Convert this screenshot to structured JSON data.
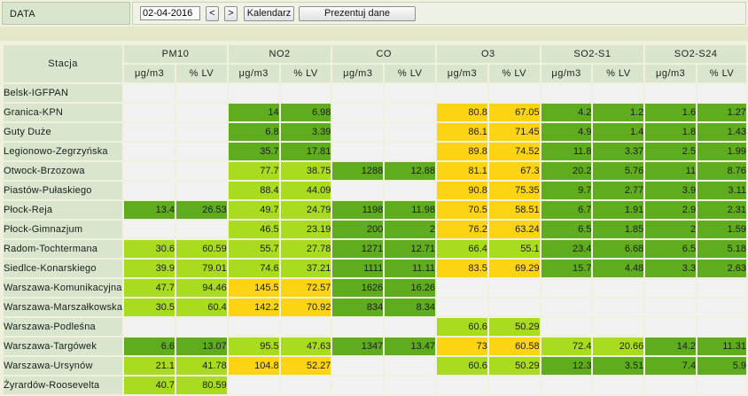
{
  "toolbar": {
    "date_label": "DATA",
    "date_value": "02-04-2016",
    "prev_label": "<",
    "next_label": ">",
    "calendar_label": "Kalendarz",
    "show_label": "Prezentuj dane"
  },
  "table": {
    "station_header": "Stacja",
    "groups": [
      "PM10",
      "NO2",
      "CO",
      "O3",
      "SO2-S1",
      "SO2-S24"
    ],
    "units": [
      "μg/m3",
      "% LV"
    ],
    "colors": {
      "e": "#f2f2f2",
      "dg": "#5fad1f",
      "lg": "#a9db1e",
      "y": "#fdd414"
    },
    "rows": [
      {
        "name": "Belsk-IGFPAN",
        "cells": [
          [
            "",
            ""
          ],
          [
            "",
            ""
          ],
          [
            "",
            ""
          ],
          [
            "",
            ""
          ],
          [
            "",
            ""
          ],
          [
            "",
            ""
          ]
        ],
        "colors": [
          "e",
          "e",
          "e",
          "e",
          "e",
          "e"
        ]
      },
      {
        "name": "Granica-KPN",
        "cells": [
          [
            "",
            ""
          ],
          [
            "14",
            "6.98"
          ],
          [
            "",
            ""
          ],
          [
            "80.8",
            "67.05"
          ],
          [
            "4.2",
            "1.2"
          ],
          [
            "1.6",
            "1.27"
          ]
        ],
        "colors": [
          "e",
          "dg",
          "e",
          "y",
          "dg",
          "dg"
        ]
      },
      {
        "name": "Guty Duże",
        "cells": [
          [
            "",
            ""
          ],
          [
            "6.8",
            "3.39"
          ],
          [
            "",
            ""
          ],
          [
            "86.1",
            "71.45"
          ],
          [
            "4.9",
            "1.4"
          ],
          [
            "1.8",
            "1.43"
          ]
        ],
        "colors": [
          "e",
          "dg",
          "e",
          "y",
          "dg",
          "dg"
        ]
      },
      {
        "name": "Legionowo-Zegrzyńska",
        "cells": [
          [
            "",
            ""
          ],
          [
            "35.7",
            "17.81"
          ],
          [
            "",
            ""
          ],
          [
            "89.8",
            "74.52"
          ],
          [
            "11.8",
            "3.37"
          ],
          [
            "2.5",
            "1.99"
          ]
        ],
        "colors": [
          "e",
          "dg",
          "e",
          "y",
          "dg",
          "dg"
        ]
      },
      {
        "name": "Otwock-Brzozowa",
        "cells": [
          [
            "",
            ""
          ],
          [
            "77.7",
            "38.75"
          ],
          [
            "1288",
            "12.88"
          ],
          [
            "81.1",
            "67.3"
          ],
          [
            "20.2",
            "5.76"
          ],
          [
            "11",
            "8.76"
          ]
        ],
        "colors": [
          "e",
          "lg",
          "dg",
          "y",
          "dg",
          "dg"
        ]
      },
      {
        "name": "Piastów-Pułaskiego",
        "cells": [
          [
            "",
            ""
          ],
          [
            "88.4",
            "44.09"
          ],
          [
            "",
            ""
          ],
          [
            "90.8",
            "75.35"
          ],
          [
            "9.7",
            "2.77"
          ],
          [
            "3.9",
            "3.11"
          ]
        ],
        "colors": [
          "e",
          "lg",
          "e",
          "y",
          "dg",
          "dg"
        ]
      },
      {
        "name": "Płock-Reja",
        "cells": [
          [
            "13.4",
            "26.53"
          ],
          [
            "49.7",
            "24.79"
          ],
          [
            "1198",
            "11.98"
          ],
          [
            "70.5",
            "58.51"
          ],
          [
            "6.7",
            "1.91"
          ],
          [
            "2.9",
            "2.31"
          ]
        ],
        "colors": [
          "dg",
          "lg",
          "dg",
          "y",
          "dg",
          "dg"
        ]
      },
      {
        "name": "Płock-Gimnazjum",
        "cells": [
          [
            "",
            ""
          ],
          [
            "46.5",
            "23.19"
          ],
          [
            "200",
            "2"
          ],
          [
            "76.2",
            "63.24"
          ],
          [
            "6.5",
            "1.85"
          ],
          [
            "2",
            "1.59"
          ]
        ],
        "colors": [
          "e",
          "lg",
          "dg",
          "y",
          "dg",
          "dg"
        ]
      },
      {
        "name": "Radom-Tochtermana",
        "cells": [
          [
            "30.6",
            "60.59"
          ],
          [
            "55.7",
            "27.78"
          ],
          [
            "1271",
            "12.71"
          ],
          [
            "66.4",
            "55.1"
          ],
          [
            "23.4",
            "6.68"
          ],
          [
            "6.5",
            "5.18"
          ]
        ],
        "colors": [
          "lg",
          "lg",
          "dg",
          "lg",
          "dg",
          "dg"
        ]
      },
      {
        "name": "Siedlce-Konarskiego",
        "cells": [
          [
            "39.9",
            "79.01"
          ],
          [
            "74.6",
            "37.21"
          ],
          [
            "1111",
            "11.11"
          ],
          [
            "83.5",
            "69.29"
          ],
          [
            "15.7",
            "4.48"
          ],
          [
            "3.3",
            "2.63"
          ]
        ],
        "colors": [
          "lg",
          "lg",
          "dg",
          "y",
          "dg",
          "dg"
        ]
      },
      {
        "name": "Warszawa-Komunikacyjna",
        "cells": [
          [
            "47.7",
            "94.46"
          ],
          [
            "145.5",
            "72.57"
          ],
          [
            "1626",
            "16.26"
          ],
          [
            "",
            ""
          ],
          [
            "",
            ""
          ],
          [
            "",
            ""
          ]
        ],
        "colors": [
          "lg",
          "y",
          "dg",
          "e",
          "e",
          "e"
        ]
      },
      {
        "name": "Warszawa-Marszałkowska",
        "cells": [
          [
            "30.5",
            "60.4"
          ],
          [
            "142.2",
            "70.92"
          ],
          [
            "834",
            "8.34"
          ],
          [
            "",
            ""
          ],
          [
            "",
            ""
          ],
          [
            "",
            ""
          ]
        ],
        "colors": [
          "lg",
          "y",
          "dg",
          "e",
          "e",
          "e"
        ]
      },
      {
        "name": "Warszawa-Podleśna",
        "cells": [
          [
            "",
            ""
          ],
          [
            "",
            ""
          ],
          [
            "",
            ""
          ],
          [
            "60.6",
            "50.29"
          ],
          [
            "",
            ""
          ],
          [
            "",
            ""
          ]
        ],
        "colors": [
          "e",
          "e",
          "e",
          "lg",
          "e",
          "e"
        ]
      },
      {
        "name": "Warszawa-Targówek",
        "cells": [
          [
            "6.6",
            "13.07"
          ],
          [
            "95.5",
            "47.63"
          ],
          [
            "1347",
            "13.47"
          ],
          [
            "73",
            "60.58"
          ],
          [
            "72.4",
            "20.66"
          ],
          [
            "14.2",
            "11.31"
          ]
        ],
        "colors": [
          "dg",
          "lg",
          "dg",
          "y",
          "lg",
          "dg"
        ]
      },
      {
        "name": "Warszawa-Ursynów",
        "cells": [
          [
            "21.1",
            "41.78"
          ],
          [
            "104.8",
            "52.27"
          ],
          [
            "",
            ""
          ],
          [
            "60.6",
            "50.29"
          ],
          [
            "12.3",
            "3.51"
          ],
          [
            "7.4",
            "5.9"
          ]
        ],
        "colors": [
          "lg",
          "y",
          "e",
          "lg",
          "dg",
          "dg"
        ]
      },
      {
        "name": "Żyrardów-Roosevelta",
        "cells": [
          [
            "40.7",
            "80.59"
          ],
          [
            "",
            ""
          ],
          [
            "",
            ""
          ],
          [
            "",
            ""
          ],
          [
            "",
            ""
          ],
          [
            "",
            ""
          ]
        ],
        "colors": [
          "lg",
          "e",
          "e",
          "e",
          "e",
          "e"
        ]
      }
    ]
  }
}
